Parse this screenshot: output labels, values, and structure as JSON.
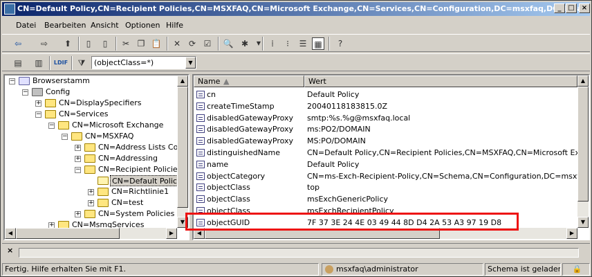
{
  "window": {
    "title": "CN=Default Policy,CN=Recipient Policies,CN=MSXFAQ,CN=Microsoft Exchange,CN=Services,CN=Configuration,DC=msxfaq,DC=local"
  },
  "menu": [
    "Datei",
    "Bearbeiten",
    "Ansicht",
    "Optionen",
    "Hilfe"
  ],
  "toolbar2": {
    "ldif_label": "LDIF",
    "filter_value": "(objectClass=*)"
  },
  "tree": [
    {
      "label": "Browserstamm"
    },
    {
      "label": "Config"
    },
    {
      "label": "CN=DisplaySpecifiers"
    },
    {
      "label": "CN=Services"
    },
    {
      "label": "CN=Microsoft Exchange"
    },
    {
      "label": "CN=MSXFAQ"
    },
    {
      "label": "CN=Address Lists Conta"
    },
    {
      "label": "CN=Addressing"
    },
    {
      "label": "CN=Recipient Policies"
    },
    {
      "label": "CN=Default Policy"
    },
    {
      "label": "CN=Richtlinie1"
    },
    {
      "label": "CN=test"
    },
    {
      "label": "CN=System Policies"
    },
    {
      "label": "CN=MsmqServices"
    }
  ],
  "list": {
    "columns": {
      "name": "Name",
      "value": "Wert"
    },
    "rows": [
      {
        "name": "cn",
        "value": "Default Policy"
      },
      {
        "name": "createTimeStamp",
        "value": "20040118183815.0Z"
      },
      {
        "name": "disabledGatewayProxy",
        "value": "smtp:%s.%g@msxfaq.local"
      },
      {
        "name": "disabledGatewayProxy",
        "value": "ms:PO2/DOMAIN"
      },
      {
        "name": "disabledGatewayProxy",
        "value": "MS:PO/DOMAIN"
      },
      {
        "name": "distinguishedName",
        "value": "CN=Default Policy,CN=Recipient Policies,CN=MSXFAQ,CN=Microsoft Exchange,C"
      },
      {
        "name": "name",
        "value": "Default Policy"
      },
      {
        "name": "objectCategory",
        "value": "CN=ms-Exch-Recipient-Policy,CN=Schema,CN=Configuration,DC=msxfaq,DC=lo"
      },
      {
        "name": "objectClass",
        "value": "top"
      },
      {
        "name": "objectClass",
        "value": "msExchGenericPolicy"
      },
      {
        "name": "objectClass",
        "value": "msExchRecipientPolicy"
      },
      {
        "name": "objectGUID",
        "value": "7F 37 3E 24 4E 03 49 44 8D D4 2A 53 A3 97 19 D8"
      }
    ]
  },
  "status": {
    "main": "Fertig. Hilfe erhalten Sie mit F1.",
    "user": "msxfaq\\administrator",
    "schema": "Schema ist geladen"
  },
  "colors": {
    "highlight_box": "#ee1111",
    "title_bar": "#0a246a"
  }
}
